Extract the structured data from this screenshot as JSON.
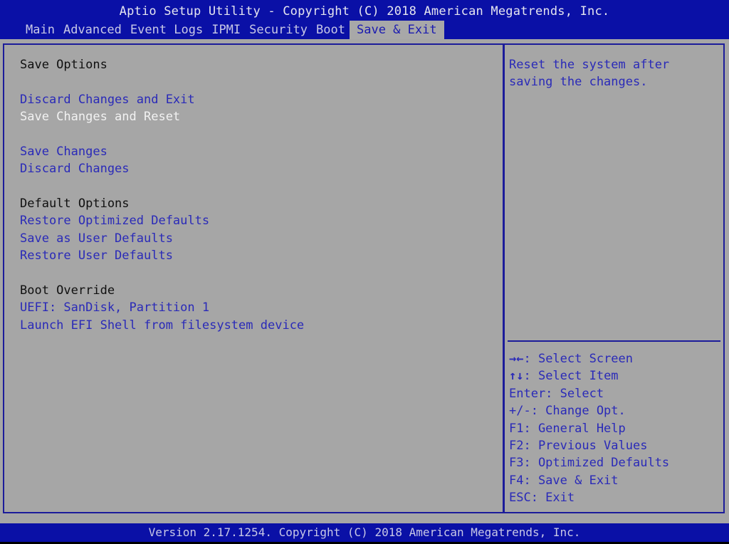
{
  "header": {
    "title": "Aptio Setup Utility - Copyright (C) 2018 American Megatrends, Inc."
  },
  "tabs": [
    {
      "label": "Main",
      "active": false
    },
    {
      "label": "Advanced",
      "active": false
    },
    {
      "label": "Event Logs",
      "active": false
    },
    {
      "label": "IPMI",
      "active": false
    },
    {
      "label": "Security",
      "active": false
    },
    {
      "label": "Boot",
      "active": false
    },
    {
      "label": "Save & Exit",
      "active": true
    }
  ],
  "main": {
    "sections": [
      {
        "type": "header",
        "label": "Save Options"
      },
      {
        "type": "option",
        "label": "Discard Changes and Exit"
      },
      {
        "type": "option",
        "label": "Save Changes and Reset",
        "selected": true
      },
      {
        "type": "option",
        "label": "Save Changes"
      },
      {
        "type": "option",
        "label": "Discard Changes"
      },
      {
        "type": "header",
        "label": "Default Options"
      },
      {
        "type": "option",
        "label": "Restore Optimized Defaults"
      },
      {
        "type": "option",
        "label": "Save as User Defaults"
      },
      {
        "type": "option",
        "label": "Restore User Defaults"
      },
      {
        "type": "header",
        "label": "Boot Override"
      },
      {
        "type": "option",
        "label": "UEFI: SanDisk, Partition 1"
      },
      {
        "type": "option",
        "label": "Launch EFI Shell from filesystem device"
      }
    ]
  },
  "help": {
    "lines": [
      "Reset the system after",
      "saving the changes."
    ]
  },
  "keys": [
    {
      "icon": "left-right-arrows-icon",
      "glyph": "→←",
      "text": ": Select Screen"
    },
    {
      "icon": "up-down-arrows-icon",
      "glyph": "↑↓",
      "text": ": Select Item"
    },
    {
      "text": "Enter: Select"
    },
    {
      "text": "+/-: Change Opt."
    },
    {
      "text": "F1: General Help"
    },
    {
      "text": "F2: Previous Values"
    },
    {
      "text": "F3: Optimized Defaults"
    },
    {
      "text": "F4: Save & Exit"
    },
    {
      "text": "ESC: Exit"
    }
  ],
  "footer": {
    "text": "Version 2.17.1254. Copyright (C) 2018 American Megatrends, Inc."
  },
  "colors": {
    "header_bg": "#0a10a6",
    "panel_bg": "#a6a6a6",
    "option_text": "#2a2ab8",
    "selected_text": "#f2f2f2"
  }
}
